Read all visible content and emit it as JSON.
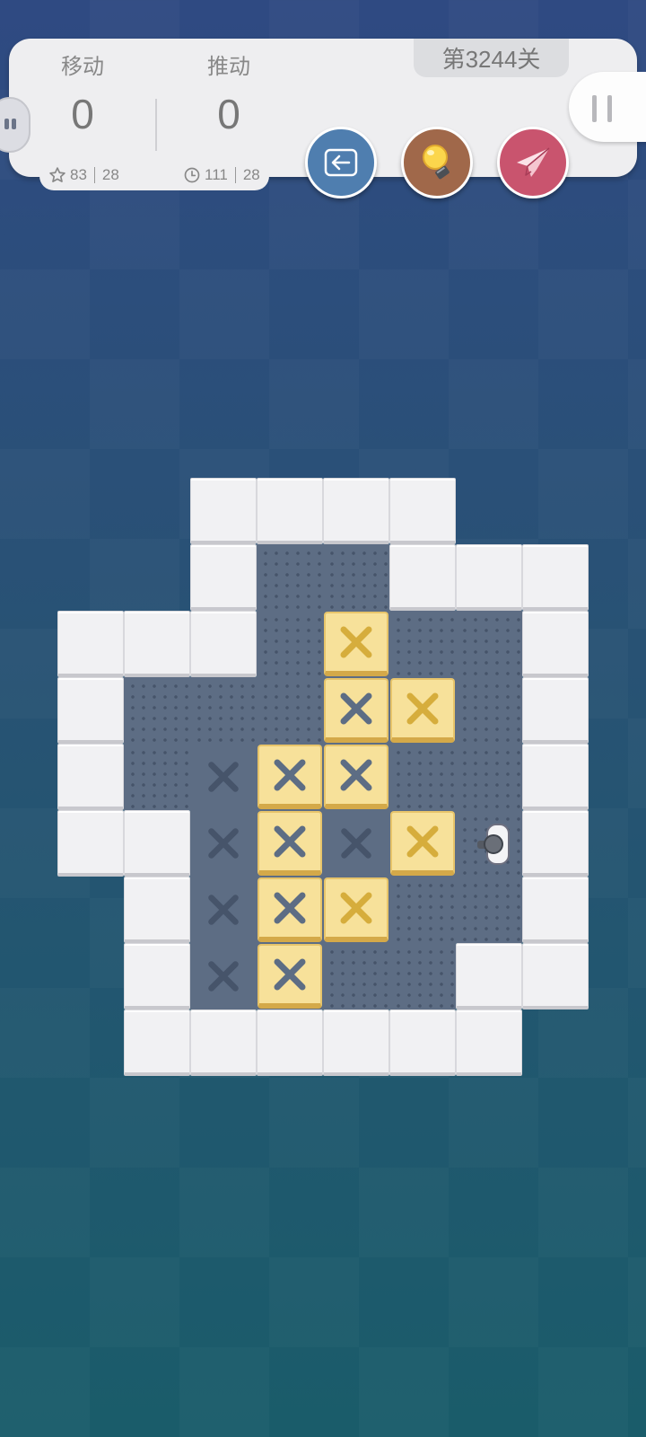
{
  "hud": {
    "level_label": "第3244关",
    "moves": {
      "label": "移动",
      "value": "0",
      "best": "83",
      "target": "28"
    },
    "pushes": {
      "label": "推动",
      "value": "0",
      "best": "111",
      "target": "28"
    }
  },
  "buttons": {
    "undo": {
      "icon": "back-arrow-icon",
      "color": "#4f7eaf"
    },
    "hint": {
      "icon": "lightbulb-icon",
      "color": "#a0684a"
    },
    "share": {
      "icon": "paper-plane-icon",
      "color": "#c9546e"
    },
    "pause": {
      "icon": "pause-icon"
    }
  },
  "colors": {
    "wall": "#f1f1f3",
    "floor": "#5d6d84",
    "box": "#f7e19a",
    "goal_on_box": "#5d6d84",
    "goal_empty": "#46546a"
  },
  "board": {
    "cols": 8,
    "rows": 9,
    "legend": {
      "#": "wall",
      ".": "floor",
      "x": "goal",
      "B": "box",
      "*": "box-on-goal",
      "@": "player",
      "-": "empty"
    },
    "map": [
      "--####--",
      "--#..###",
      "###.B..#",
      "#...*B.#",
      "#.x**..#",
      "##x*xB@#",
      "-#x*B..#",
      "-#x*..##",
      "-######-"
    ]
  }
}
